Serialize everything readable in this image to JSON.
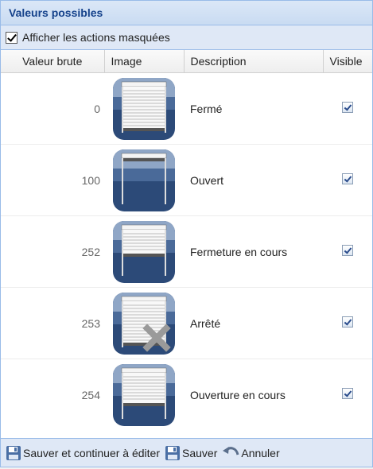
{
  "panel": {
    "title": "Valeurs possibles"
  },
  "show_hidden": {
    "label": "Afficher les actions masquées",
    "checked": true
  },
  "columns": {
    "raw_value": "Valeur brute",
    "image": "Image",
    "description": "Description",
    "visible": "Visible"
  },
  "rows": [
    {
      "value": "0",
      "description": "Fermé",
      "icon": "shutter-closed-icon",
      "visible": true
    },
    {
      "value": "100",
      "description": "Ouvert",
      "icon": "shutter-open-icon",
      "visible": true
    },
    {
      "value": "252",
      "description": "Fermeture en cours",
      "icon": "shutter-closing-icon",
      "visible": true
    },
    {
      "value": "253",
      "description": "Arrêté",
      "icon": "shutter-stopped-icon",
      "visible": true
    },
    {
      "value": "254",
      "description": "Ouverture en cours",
      "icon": "shutter-opening-icon",
      "visible": true
    }
  ],
  "footer": {
    "save_continue": "Sauver et continuer à éditer",
    "save": "Sauver",
    "cancel": "Annuler"
  }
}
